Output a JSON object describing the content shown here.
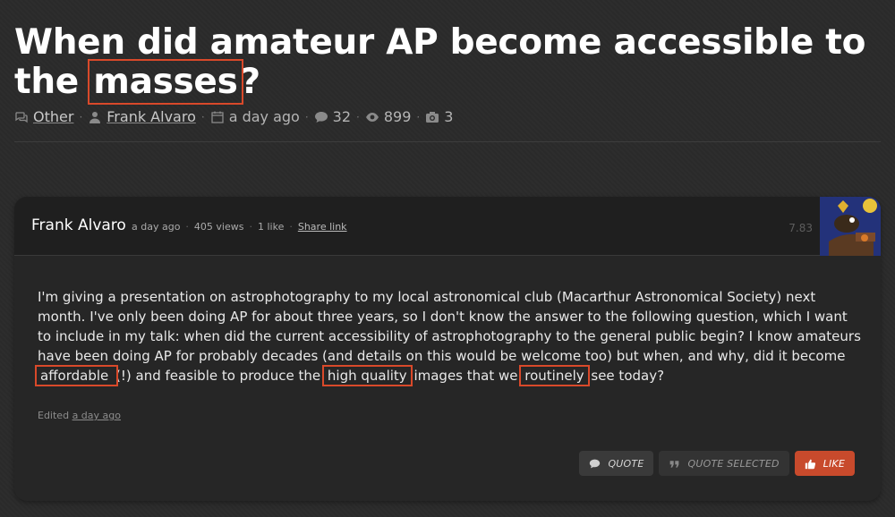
{
  "thread": {
    "title_part1": "When did amateur AP become accessible to the ",
    "title_highlight": "masses",
    "title_part2": "?",
    "category": "Other",
    "author": "Frank Alvaro",
    "posted": "a day ago",
    "replies": "32",
    "views": "899",
    "images": "3",
    "icons": [
      "chat-bubbles-icon",
      "user-icon",
      "calendar-icon",
      "comment-icon",
      "eye-icon",
      "camera-icon"
    ]
  },
  "post": {
    "author": "Frank Alvaro",
    "time": "a day ago",
    "views": "405 views",
    "likes": "1 like",
    "share": "Share link",
    "score": "7.83",
    "text_1": "I'm  giving a presentation on astrophotography to my local astronomical club (Macarthur Astronomical Society) next month. I've only been doing AP for about three years, so I don't know the answer to the following question, which I want to include in my talk: when did the current accessibility of astrophotography to the general public begin? I know amateurs have been doing AP for probably decades (and details on this would be welcome too) but when, and why, did it become ",
    "hl_1": "affordable ",
    "text_2": "(!) and feasible to produce the ",
    "hl_2": "high quality",
    "text_3": " images that we ",
    "hl_3": "routinely",
    "text_4": " see today?",
    "edited_label": "Edited ",
    "edited_time": "a day ago"
  },
  "actions": {
    "quote": "QUOTE",
    "quote_selected": "QUOTE SELECTED",
    "like": "LIKE"
  },
  "colors": {
    "highlight_border": "#d9492a",
    "like_button": "#c84a2c"
  }
}
